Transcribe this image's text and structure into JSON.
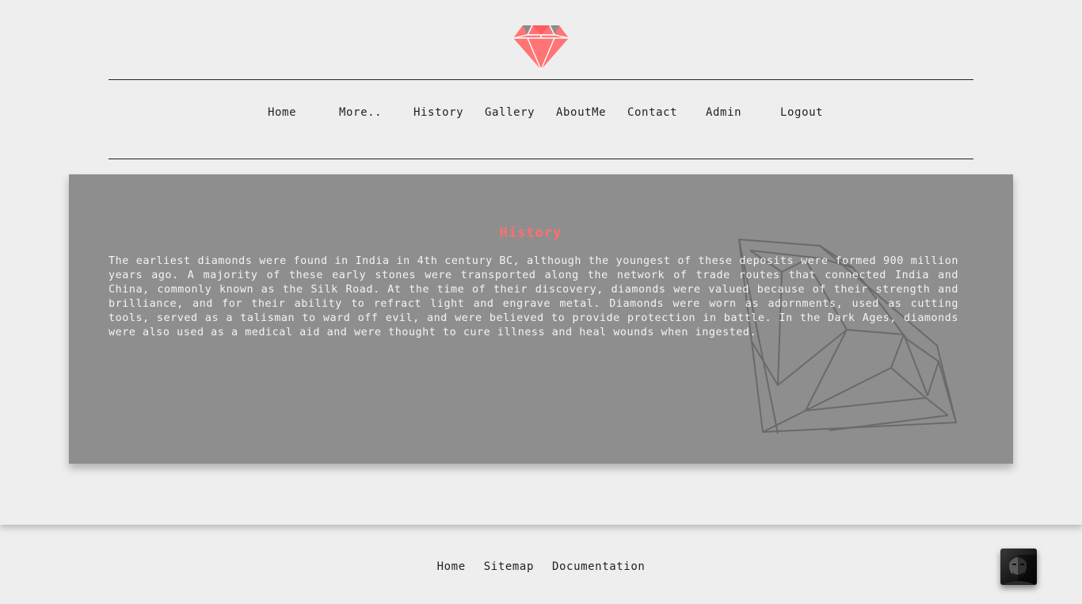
{
  "nav": {
    "items": [
      "Home",
      "More..",
      "History",
      "Gallery",
      "AboutMe",
      "Contact",
      "Admin",
      "Logout"
    ]
  },
  "main": {
    "title": "History",
    "text": "The earliest diamonds were found in India in 4th century BC, although the youngest of these deposits were formed 900 million years ago. A majority of these early stones were transported along the network of trade routes that connected India and China, commonly known as the Silk Road. At the time of their discovery, diamonds were valued because of their strength and brilliance, and for their ability to refract light and engrave metal. Diamonds were worn as adornments, used as cutting tools, served as a talisman to ward off evil, and were believed to provide protection in battle. In the Dark Ages, diamonds were also used as a medical aid and were thought to cure illness and heal wounds when ingested."
  },
  "footer": {
    "links": [
      "Home",
      "Sitemap",
      "Documentation"
    ]
  },
  "colors": {
    "background": "#eeeeee",
    "panel": "#8e8e8e",
    "accent": "#ff7070",
    "logo_facet": "#999999"
  },
  "icons": {
    "logo": "diamond-logo-icon",
    "panel_watermark": "diamond-outline-icon",
    "user": "user-avatar"
  }
}
